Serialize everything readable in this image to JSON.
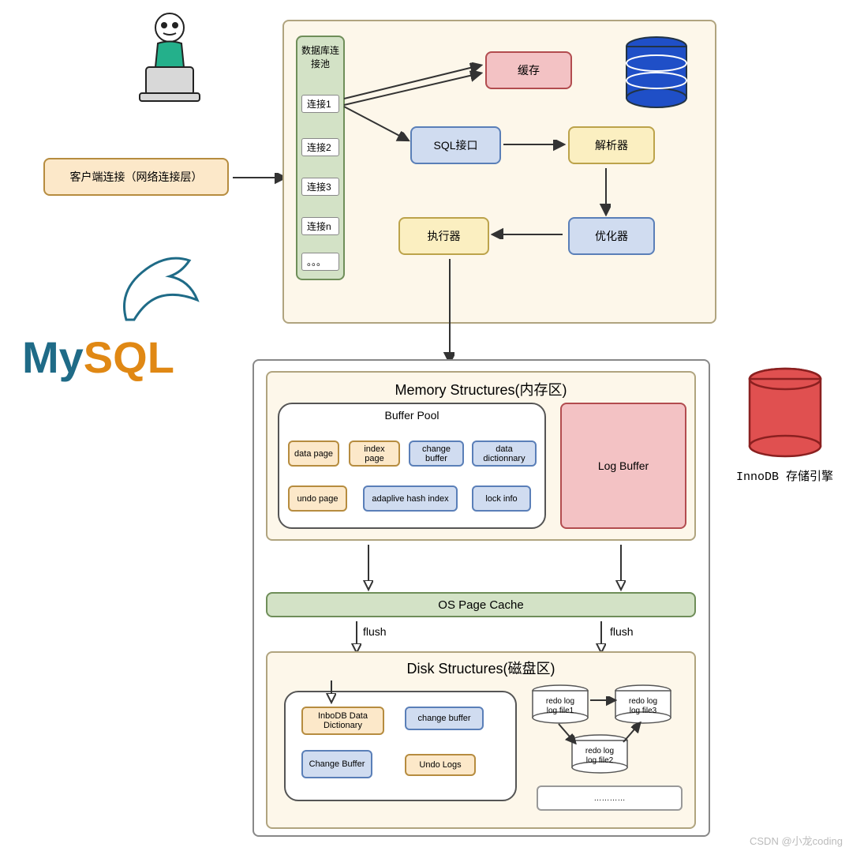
{
  "client_box": "客户端连接（网络连接层）",
  "mysql_logo": {
    "my": "My",
    "sql": "SQL"
  },
  "top_panel": {
    "pool_title": "数据库连接池",
    "conns": [
      "连接1",
      "连接2",
      "连接3",
      "连接n",
      "。。。"
    ],
    "cache": "缓存",
    "sql_interface": "SQL接口",
    "parser": "解析器",
    "optimizer": "优化器",
    "executor": "执行器"
  },
  "memory": {
    "title": "Memory Structures(内存区)",
    "buffer_pool_title": "Buffer Pool",
    "items_row1": [
      "data page",
      "index page",
      "change buffer",
      "data dictionnary"
    ],
    "items_row2": [
      "undo page",
      "adaplive hash index",
      "lock info"
    ],
    "log_buffer": "Log Buffer"
  },
  "os_cache": "OS Page Cache",
  "flush_labels": {
    "left": "flush",
    "right": "flush"
  },
  "disk": {
    "title": "Disk Structures(磁盘区)",
    "left_items": [
      "InboDB Data Dictionary",
      "change buffer",
      "Change Buffer",
      "Undo Logs"
    ],
    "redo_logs": [
      "redo log\nlog file1",
      "redo log\nlog file3",
      "redo log\nlog file2"
    ],
    "dots": "…………"
  },
  "innodb_label": "InnoDB 存储引擎",
  "watermark": "CSDN @小龙coding",
  "colors": {
    "orange": "#fce8c9",
    "red": "#f3c2c4",
    "yellow": "#fbefc1",
    "blue": "#d0dcf0",
    "green": "#d3e2c6",
    "cream": "#fdf7ea"
  }
}
